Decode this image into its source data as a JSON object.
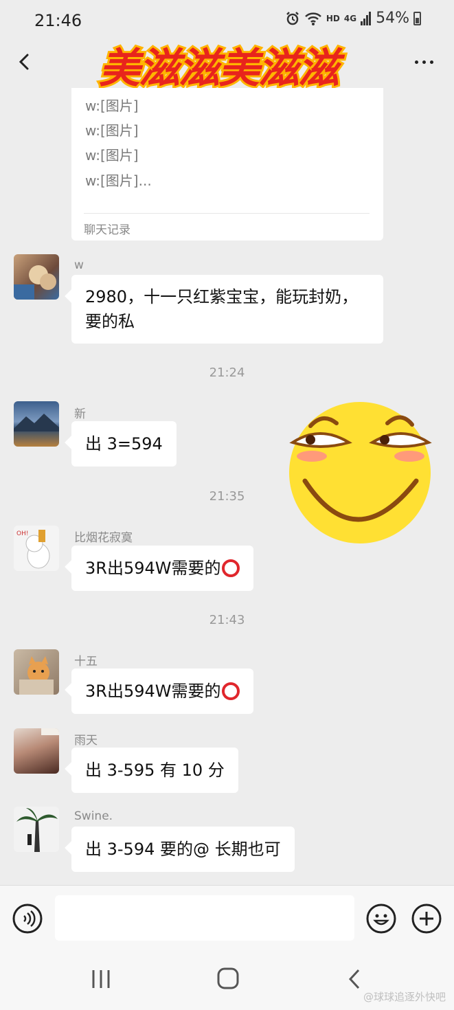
{
  "status": {
    "time": "21:46",
    "network": "HD",
    "signal": "4G",
    "battery": "54%"
  },
  "header": {
    "title": "美滋滋美滋滋"
  },
  "forwarded_card": {
    "lines": [
      "w:[图片]",
      "w:[图片]",
      "w:[图片]",
      "w:[图片]..."
    ],
    "footer": "聊天记录"
  },
  "messages": [
    {
      "sender": "w",
      "text": "2980，十一只红紫宝宝，能玩封奶，要的私"
    },
    {
      "timestamp": "21:24"
    },
    {
      "sender": "新",
      "text": "出 3=594"
    },
    {
      "timestamp": "21:35"
    },
    {
      "sender": "比烟花寂寞",
      "text": "3R出594W需要的"
    },
    {
      "timestamp": "21:43"
    },
    {
      "sender": "十五",
      "text": "3R出594W需要的"
    },
    {
      "sender": "雨天",
      "text": "出 3-595 有 10 分"
    },
    {
      "sender": "Swine.",
      "text": "出 3-594 要的@   长期也可"
    }
  ],
  "input": {
    "placeholder": ""
  },
  "watermark": "@球球追逐外快吧",
  "colors": {
    "background": "#ededed",
    "bubble": "#ffffff",
    "red_circle": "#e0262c",
    "title_fill": "#e8241c",
    "title_outline": "#ffb400"
  }
}
